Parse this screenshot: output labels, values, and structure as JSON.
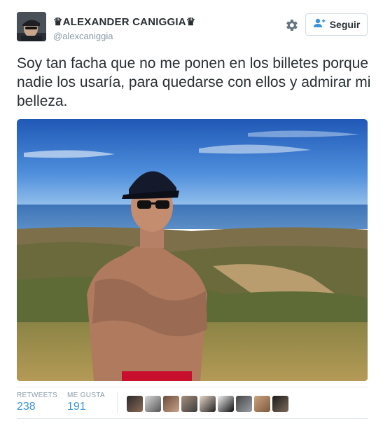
{
  "tweet": {
    "display_name": "♛ALEXANDER CANIGGIA♛",
    "handle": "@alexcaniggia",
    "text": "Soy tan facha que no me ponen en los billetes porque nadie los usaría, para quedarse con ellos y admirar mi belleza."
  },
  "actions": {
    "follow_label": "Seguir",
    "settings_icon": "gear-icon",
    "follow_icon": "add-user-icon"
  },
  "stats": {
    "retweets_label": "RETWEETS",
    "retweets_value": "238",
    "likes_label": "ME GUSTA",
    "likes_value": "191"
  },
  "colors": {
    "text": "#292f33",
    "muted": "#8899a6",
    "link": "#3b94d9",
    "border": "#e1e8ed"
  }
}
